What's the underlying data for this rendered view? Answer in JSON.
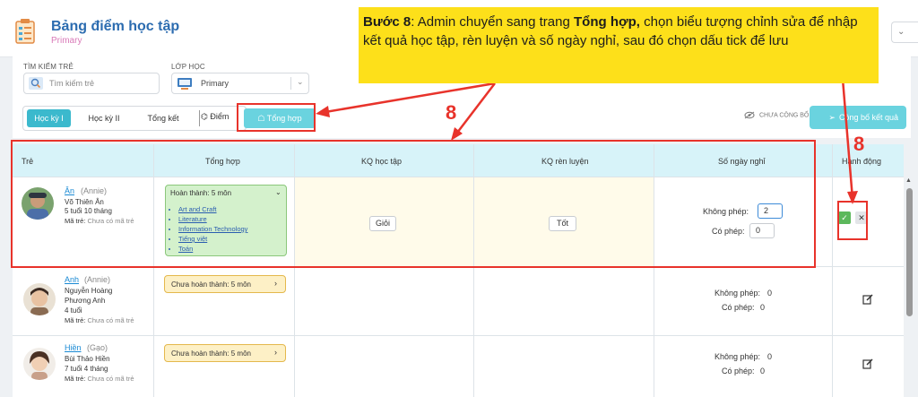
{
  "header": {
    "title": "Bảng điểm học tập",
    "subtitle": "Primary"
  },
  "filters": {
    "search_label": "TÌM KIẾM TRẺ",
    "search_placeholder": "Tìm kiếm trẻ",
    "class_label": "LỚP HỌC",
    "class_value": "Primary"
  },
  "tabs": [
    {
      "label": "Học kỳ I",
      "active": true
    },
    {
      "label": "Học kỳ II",
      "active": false
    },
    {
      "label": "Tổng kết",
      "active": false
    }
  ],
  "toolbar": {
    "diem_label": "Điểm",
    "tonghop_label": "Tổng hợp",
    "unpublished_label": "CHƯA CÔNG BỐ",
    "publish_label": "Công bố kết quả"
  },
  "table": {
    "headers": [
      "Trẻ",
      "Tổng hợp",
      "KQ học tập",
      "KQ rèn luyện",
      "Số ngày nghỉ",
      "Hành động"
    ],
    "code_label": "Mã trẻ:",
    "code_empty": "Chưa có mã trẻ",
    "absent_unexcused": "Không phép:",
    "absent_excused": "Có phép:",
    "rows": [
      {
        "name": "Ân",
        "nickname": "(Annie)",
        "fullname": "Võ Thiên Ân",
        "age": "5 tuổi 10 tháng",
        "summary": "Hoàn thành: 5 môn",
        "subjects": [
          "Art and Craft",
          "Literature",
          "Information Technology",
          "Tiếng việt",
          "Toán"
        ],
        "academic": "Giỏi",
        "conduct": "Tốt",
        "absent_unexcused": "2",
        "absent_excused": "0"
      },
      {
        "name": "Anh",
        "nickname": "(Annie)",
        "fullname_1": "Nguyễn Hoàng",
        "fullname_2": "Phương Anh",
        "age": "4 tuổi",
        "summary": "Chưa hoàn thành: 5 môn",
        "absent_unexcused": "0",
        "absent_excused": "0"
      },
      {
        "name": "Hiền",
        "nickname": "(Gạo)",
        "fullname": "Bùi Thảo Hiền",
        "age": "7 tuổi 4 tháng",
        "summary": "Chưa hoàn thành: 5 môn",
        "absent_unexcused": "0",
        "absent_excused": "0"
      }
    ]
  },
  "callout": {
    "step": "Bước 8",
    "text_1": ": Admin chuyển sang trang ",
    "bold": "Tổng hợp,",
    "text_2": " chọn biểu tượng chỉnh sửa để nhập kết quả học tập, rèn luyện và số ngày nghỉ, sau đó chọn dấu tick để lưu"
  },
  "badges": {
    "step_a": "8",
    "step_b": "8"
  },
  "colors": {
    "accent": "#3bb9cd",
    "highlight": "#e8332b",
    "callout_bg": "#fde01a",
    "save": "#5cb85c"
  }
}
